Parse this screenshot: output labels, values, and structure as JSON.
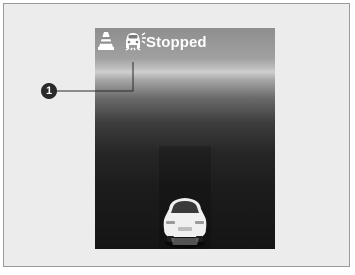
{
  "display": {
    "status_text": "Stopped",
    "status_icon": "acc-vehicle-icon",
    "left_icon": "traffic-cone-icon",
    "vehicle_icon": "car-rear-icon"
  },
  "callout": {
    "number": "1"
  },
  "colors": {
    "frame_bg": "#ececec",
    "frame_border": "#9a9a9a",
    "text": "#ffffff",
    "marker": "#2a2a2a"
  }
}
